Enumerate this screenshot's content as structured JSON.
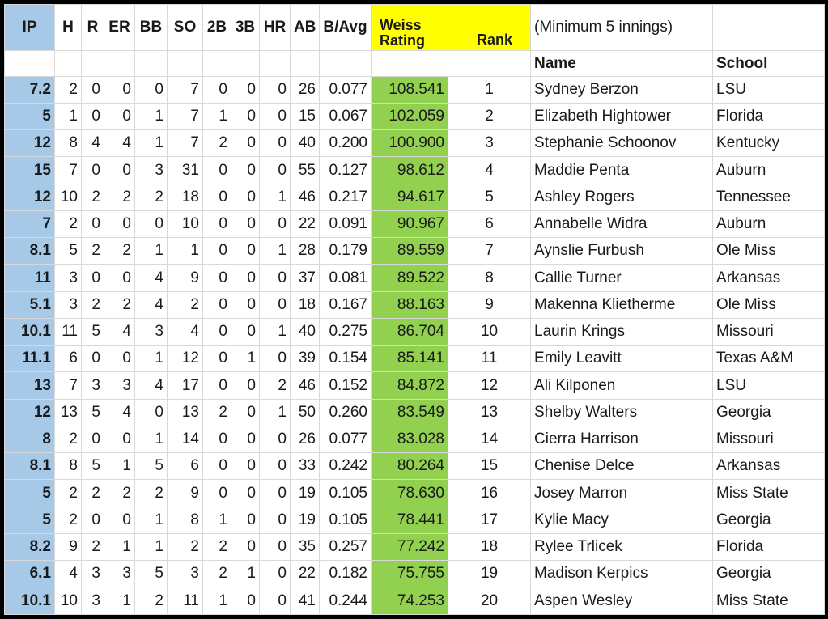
{
  "sheet": {
    "note": "(Minimum 5 innings)",
    "colors": {
      "ip_column": "#a6c9e8",
      "rating_column": "#92d050",
      "rating_header": "#ffff00",
      "border": "#000000",
      "gridline": "#d9d9d9"
    }
  },
  "headers": {
    "stats": [
      "IP",
      "H",
      "R",
      "ER",
      "BB",
      "SO",
      "2B",
      "3B",
      "HR",
      "AB",
      "B/Avg"
    ],
    "rating_line1": "Weiss",
    "rating_line2": "Rating",
    "rank": "Rank",
    "name": "Name",
    "school": "School"
  },
  "chart_data": {
    "type": "table",
    "title": "Weiss Rating",
    "subtitle": "(Minimum 5 innings)",
    "columns": [
      "IP",
      "H",
      "R",
      "ER",
      "BB",
      "SO",
      "2B",
      "3B",
      "HR",
      "AB",
      "B/Avg",
      "Weiss Rating",
      "Rank",
      "Name",
      "School"
    ],
    "rows": [
      {
        "IP": "7.2",
        "H": "2",
        "R": "0",
        "ER": "0",
        "BB": "0",
        "SO": "7",
        "2B": "0",
        "3B": "0",
        "HR": "0",
        "AB": "26",
        "BAvg": "0.077",
        "rating": "108.541",
        "rank": "1",
        "name": "Sydney Berzon",
        "school": "LSU"
      },
      {
        "IP": "5",
        "H": "1",
        "R": "0",
        "ER": "0",
        "BB": "1",
        "SO": "7",
        "2B": "1",
        "3B": "0",
        "HR": "0",
        "AB": "15",
        "BAvg": "0.067",
        "rating": "102.059",
        "rank": "2",
        "name": "Elizabeth Hightower",
        "school": "Florida"
      },
      {
        "IP": "12",
        "H": "8",
        "R": "4",
        "ER": "4",
        "BB": "1",
        "SO": "7",
        "2B": "2",
        "3B": "0",
        "HR": "0",
        "AB": "40",
        "BAvg": "0.200",
        "rating": "100.900",
        "rank": "3",
        "name": "Stephanie Schoonov",
        "school": "Kentucky"
      },
      {
        "IP": "15",
        "H": "7",
        "R": "0",
        "ER": "0",
        "BB": "3",
        "SO": "31",
        "2B": "0",
        "3B": "0",
        "HR": "0",
        "AB": "55",
        "BAvg": "0.127",
        "rating": "98.612",
        "rank": "4",
        "name": "Maddie Penta",
        "school": "Auburn"
      },
      {
        "IP": "12",
        "H": "10",
        "R": "2",
        "ER": "2",
        "BB": "2",
        "SO": "18",
        "2B": "0",
        "3B": "0",
        "HR": "1",
        "AB": "46",
        "BAvg": "0.217",
        "rating": "94.617",
        "rank": "5",
        "name": "Ashley Rogers",
        "school": "Tennessee"
      },
      {
        "IP": "7",
        "H": "2",
        "R": "0",
        "ER": "0",
        "BB": "0",
        "SO": "10",
        "2B": "0",
        "3B": "0",
        "HR": "0",
        "AB": "22",
        "BAvg": "0.091",
        "rating": "90.967",
        "rank": "6",
        "name": "Annabelle Widra",
        "school": "Auburn"
      },
      {
        "IP": "8.1",
        "H": "5",
        "R": "2",
        "ER": "2",
        "BB": "1",
        "SO": "1",
        "2B": "0",
        "3B": "0",
        "HR": "1",
        "AB": "28",
        "BAvg": "0.179",
        "rating": "89.559",
        "rank": "7",
        "name": "Aynslie Furbush",
        "school": "Ole Miss"
      },
      {
        "IP": "11",
        "H": "3",
        "R": "0",
        "ER": "0",
        "BB": "4",
        "SO": "9",
        "2B": "0",
        "3B": "0",
        "HR": "0",
        "AB": "37",
        "BAvg": "0.081",
        "rating": "89.522",
        "rank": "8",
        "name": "Callie Turner",
        "school": "Arkansas"
      },
      {
        "IP": "5.1",
        "H": "3",
        "R": "2",
        "ER": "2",
        "BB": "4",
        "SO": "2",
        "2B": "0",
        "3B": "0",
        "HR": "0",
        "AB": "18",
        "BAvg": "0.167",
        "rating": "88.163",
        "rank": "9",
        "name": "Makenna Klietherme",
        "school": "Ole Miss"
      },
      {
        "IP": "10.1",
        "H": "11",
        "R": "5",
        "ER": "4",
        "BB": "3",
        "SO": "4",
        "2B": "0",
        "3B": "0",
        "HR": "1",
        "AB": "40",
        "BAvg": "0.275",
        "rating": "86.704",
        "rank": "10",
        "name": "Laurin Krings",
        "school": "Missouri"
      },
      {
        "IP": "11.1",
        "H": "6",
        "R": "0",
        "ER": "0",
        "BB": "1",
        "SO": "12",
        "2B": "0",
        "3B": "1",
        "HR": "0",
        "AB": "39",
        "BAvg": "0.154",
        "rating": "85.141",
        "rank": "11",
        "name": "Emily Leavitt",
        "school": "Texas A&M"
      },
      {
        "IP": "13",
        "H": "7",
        "R": "3",
        "ER": "3",
        "BB": "4",
        "SO": "17",
        "2B": "0",
        "3B": "0",
        "HR": "2",
        "AB": "46",
        "BAvg": "0.152",
        "rating": "84.872",
        "rank": "12",
        "name": "Ali Kilponen",
        "school": "LSU"
      },
      {
        "IP": "12",
        "H": "13",
        "R": "5",
        "ER": "4",
        "BB": "0",
        "SO": "13",
        "2B": "2",
        "3B": "0",
        "HR": "1",
        "AB": "50",
        "BAvg": "0.260",
        "rating": "83.549",
        "rank": "13",
        "name": "Shelby Walters",
        "school": "Georgia"
      },
      {
        "IP": "8",
        "H": "2",
        "R": "0",
        "ER": "0",
        "BB": "1",
        "SO": "14",
        "2B": "0",
        "3B": "0",
        "HR": "0",
        "AB": "26",
        "BAvg": "0.077",
        "rating": "83.028",
        "rank": "14",
        "name": "Cierra Harrison",
        "school": "Missouri"
      },
      {
        "IP": "8.1",
        "H": "8",
        "R": "5",
        "ER": "1",
        "BB": "5",
        "SO": "6",
        "2B": "0",
        "3B": "0",
        "HR": "0",
        "AB": "33",
        "BAvg": "0.242",
        "rating": "80.264",
        "rank": "15",
        "name": "Chenise Delce",
        "school": "Arkansas"
      },
      {
        "IP": "5",
        "H": "2",
        "R": "2",
        "ER": "2",
        "BB": "2",
        "SO": "9",
        "2B": "0",
        "3B": "0",
        "HR": "0",
        "AB": "19",
        "BAvg": "0.105",
        "rating": "78.630",
        "rank": "16",
        "name": "Josey Marron",
        "school": "Miss State"
      },
      {
        "IP": "5",
        "H": "2",
        "R": "0",
        "ER": "0",
        "BB": "1",
        "SO": "8",
        "2B": "1",
        "3B": "0",
        "HR": "0",
        "AB": "19",
        "BAvg": "0.105",
        "rating": "78.441",
        "rank": "17",
        "name": "Kylie Macy",
        "school": "Georgia"
      },
      {
        "IP": "8.2",
        "H": "9",
        "R": "2",
        "ER": "1",
        "BB": "1",
        "SO": "2",
        "2B": "2",
        "3B": "0",
        "HR": "0",
        "AB": "35",
        "BAvg": "0.257",
        "rating": "77.242",
        "rank": "18",
        "name": "Rylee Trlicek",
        "school": "Florida"
      },
      {
        "IP": "6.1",
        "H": "4",
        "R": "3",
        "ER": "3",
        "BB": "5",
        "SO": "3",
        "2B": "2",
        "3B": "1",
        "HR": "0",
        "AB": "22",
        "BAvg": "0.182",
        "rating": "75.755",
        "rank": "19",
        "name": "Madison Kerpics",
        "school": "Georgia"
      },
      {
        "IP": "10.1",
        "H": "10",
        "R": "3",
        "ER": "1",
        "BB": "2",
        "SO": "11",
        "2B": "1",
        "3B": "0",
        "HR": "0",
        "AB": "41",
        "BAvg": "0.244",
        "rating": "74.253",
        "rank": "20",
        "name": "Aspen Wesley",
        "school": "Miss State"
      }
    ]
  }
}
